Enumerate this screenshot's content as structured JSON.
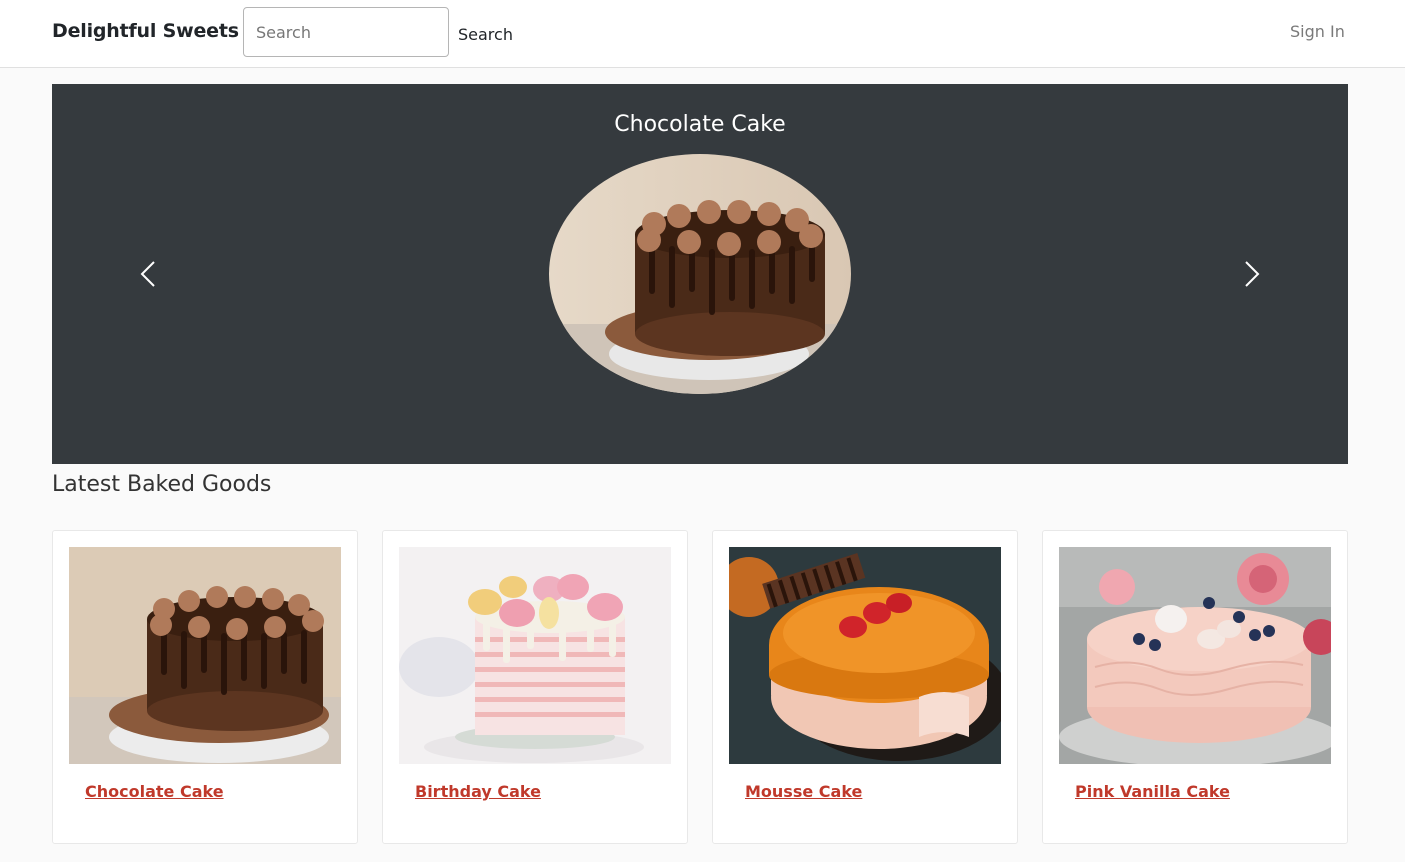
{
  "header": {
    "brand": "Delightful Sweets",
    "search_placeholder": "Search",
    "search_button": "Search",
    "signin": "Sign In"
  },
  "carousel": {
    "title": "Chocolate Cake",
    "prev_icon": "chevron-left-icon",
    "next_icon": "chevron-right-icon"
  },
  "section": {
    "title": "Latest Baked Goods"
  },
  "products": [
    {
      "name": "Chocolate Cake"
    },
    {
      "name": "Birthday Cake"
    },
    {
      "name": "Mousse Cake"
    },
    {
      "name": "Pink Vanilla Cake"
    }
  ],
  "colors": {
    "carousel_bg": "#353a3e",
    "link": "#c0392b"
  }
}
